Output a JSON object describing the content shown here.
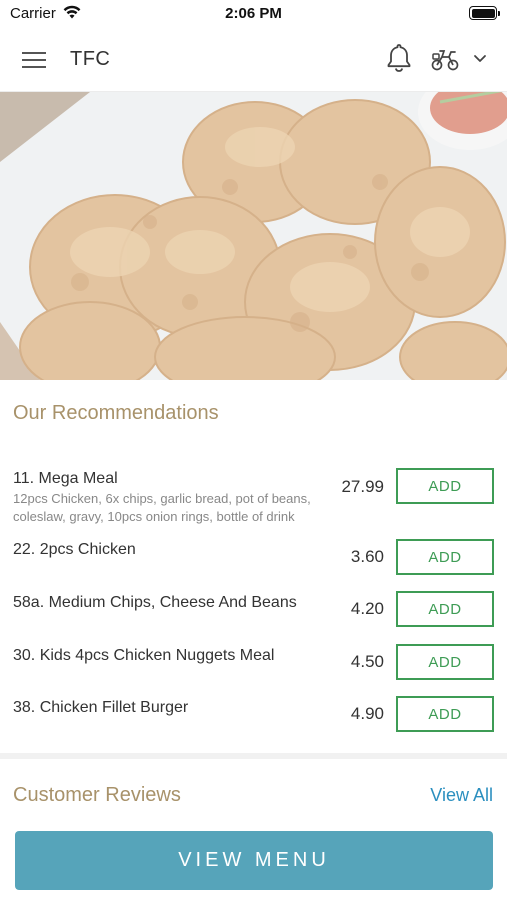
{
  "status_bar": {
    "carrier": "Carrier",
    "time": "2:06 PM"
  },
  "header": {
    "title": "TFC",
    "icons": [
      "menu-icon",
      "bell-icon",
      "scooter-icon",
      "chevron-down-icon"
    ]
  },
  "hero": {
    "image": "fried chicken photo"
  },
  "recommendations": {
    "title": "Our Recommendations",
    "add_label": "ADD",
    "items": [
      {
        "name": "11. Mega Meal",
        "description": "12pcs Chicken, 6x chips, garlic bread, pot of beans, coleslaw, gravy, 10pcs onion rings, bottle of drink",
        "price": "27.99"
      },
      {
        "name": "22. 2pcs Chicken",
        "description": "",
        "price": "3.60"
      },
      {
        "name": "58a. Medium Chips, Cheese And Beans",
        "description": "",
        "price": "4.20"
      },
      {
        "name": "30. Kids 4pcs Chicken Nuggets Meal",
        "description": "",
        "price": "4.50"
      },
      {
        "name": "38. Chicken Fillet Burger",
        "description": "",
        "price": "4.90"
      }
    ]
  },
  "reviews": {
    "title": "Customer Reviews",
    "view_all": "View All"
  },
  "footer": {
    "view_menu": "VIEW MENU"
  },
  "colors": {
    "accent_gold": "#a8926a",
    "add_green": "#3e9c55",
    "link_blue": "#2b8fbf",
    "button_teal": "#56a4ba"
  }
}
